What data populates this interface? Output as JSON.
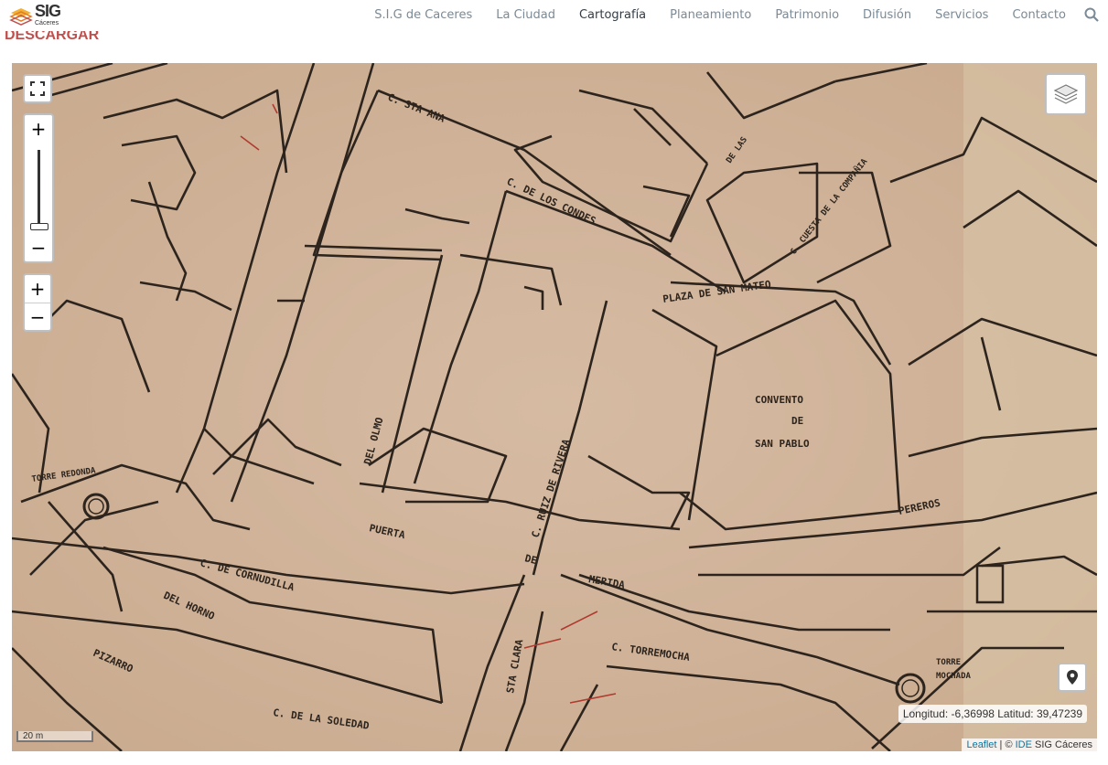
{
  "logo": {
    "name": "SIG",
    "subtitle": "Cáceres"
  },
  "nav": [
    {
      "label": "S.I.G de Caceres",
      "active": false
    },
    {
      "label": "La Ciudad",
      "active": false
    },
    {
      "label": "Cartografía",
      "active": true
    },
    {
      "label": "Planeamiento",
      "active": false
    },
    {
      "label": "Patrimonio",
      "active": false
    },
    {
      "label": "Difusión",
      "active": false
    },
    {
      "label": "Servicios",
      "active": false
    },
    {
      "label": "Contacto",
      "active": false
    }
  ],
  "page": {
    "download_label": "DESCARGAR"
  },
  "map": {
    "zoom_in": "+",
    "zoom_out": "−",
    "coordinates": "Longitud: -6,36998 Latitud: 39,47239",
    "scale": "20 m",
    "attribution": {
      "leaflet": "Leaflet",
      "separator": " | © ",
      "ide": "IDE",
      "rest": " SIG Cáceres"
    },
    "labels": {
      "convento": [
        "CONVENTO",
        "DE",
        "SAN PABLO"
      ],
      "plaza": "PLAZA DE SAN MATEO",
      "condes": "C. DE LOS CONDES",
      "santa_ana": "C. STA ANA",
      "cornudilla": "C. DE CORNUDILLA",
      "horno": "DEL HORNO",
      "pizarro": "PIZARRO",
      "soledad": "C. DE LA SOLEDAD",
      "torremocha": "C. TORREMOCHA",
      "puerta": "PUERTA",
      "de": "DE",
      "merida": "MERIDA",
      "torre_redonda": "TORRE REDONDA",
      "torre_mochada": [
        "TORRE",
        "MOCHADA"
      ],
      "pereros": "PEREROS",
      "rivera": "C. RUIZ DE RIVERA",
      "olmo": "DEL OLMO",
      "clara": "STA CLARA",
      "cuesta": "C. CUESTA DE LA COMPAÑIA",
      "de_las": "DE LAS"
    }
  },
  "colors": {
    "paper": "#d2b59c",
    "ink": "#2c241d",
    "accent": "#c0504d"
  }
}
